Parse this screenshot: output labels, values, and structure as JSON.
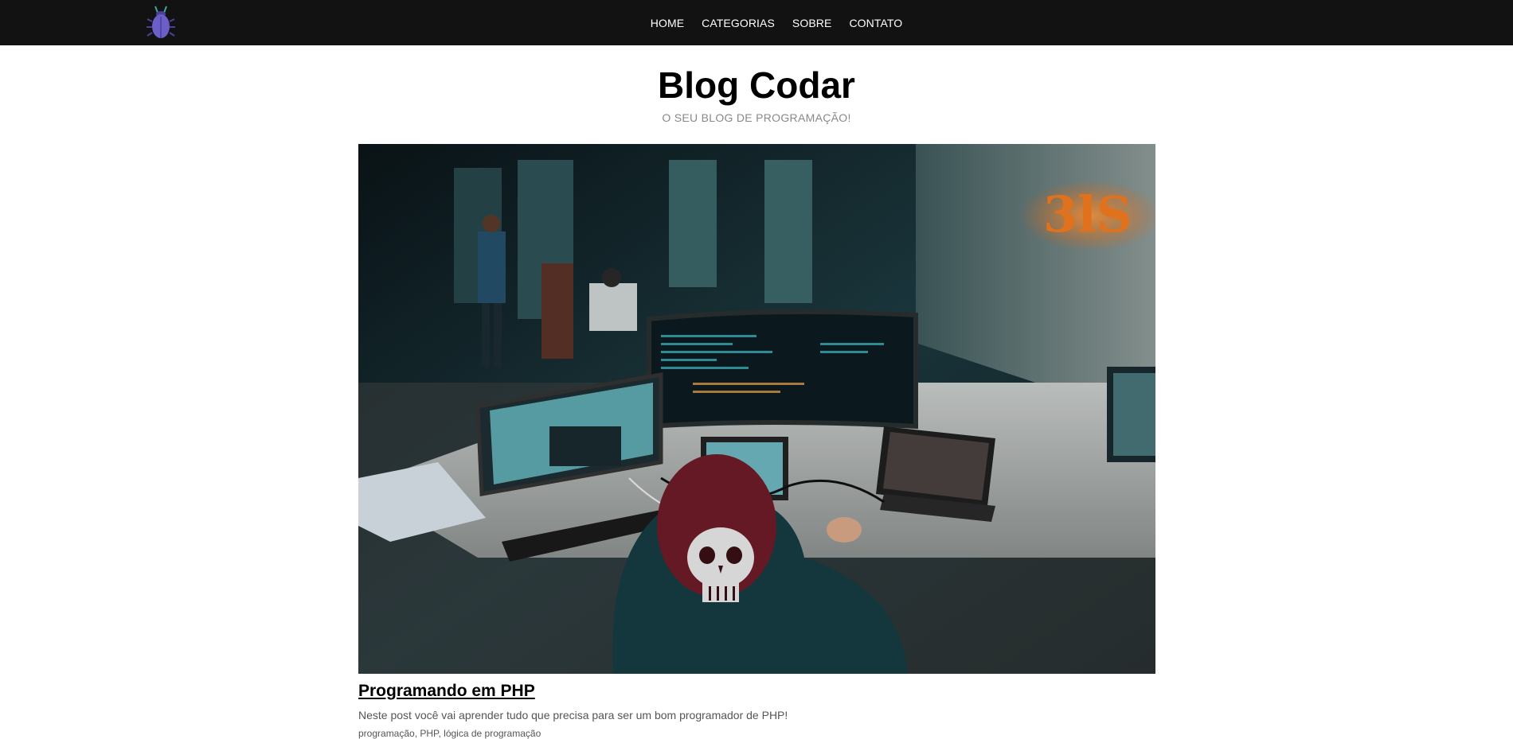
{
  "nav": {
    "logo_icon": "bug-logo-icon",
    "links": [
      {
        "label": "HOME"
      },
      {
        "label": "CATEGORIAS"
      },
      {
        "label": "SOBRE"
      },
      {
        "label": "CONTATO"
      }
    ]
  },
  "header": {
    "title": "Blog Codar",
    "subtitle": "O SEU BLOG DE PROGRAMAÇÃO!"
  },
  "post": {
    "image_subject": "developer-workspace-photo",
    "title": "Programando em PHP",
    "excerpt": "Neste post você vai aprender tudo que precisa para ser um bom programador de PHP!",
    "tags": "programação, PHP, lógica de programação"
  },
  "colors": {
    "navbar_bg": "#121212",
    "logo_body": "#6b5fc7",
    "subtitle": "#888888"
  }
}
